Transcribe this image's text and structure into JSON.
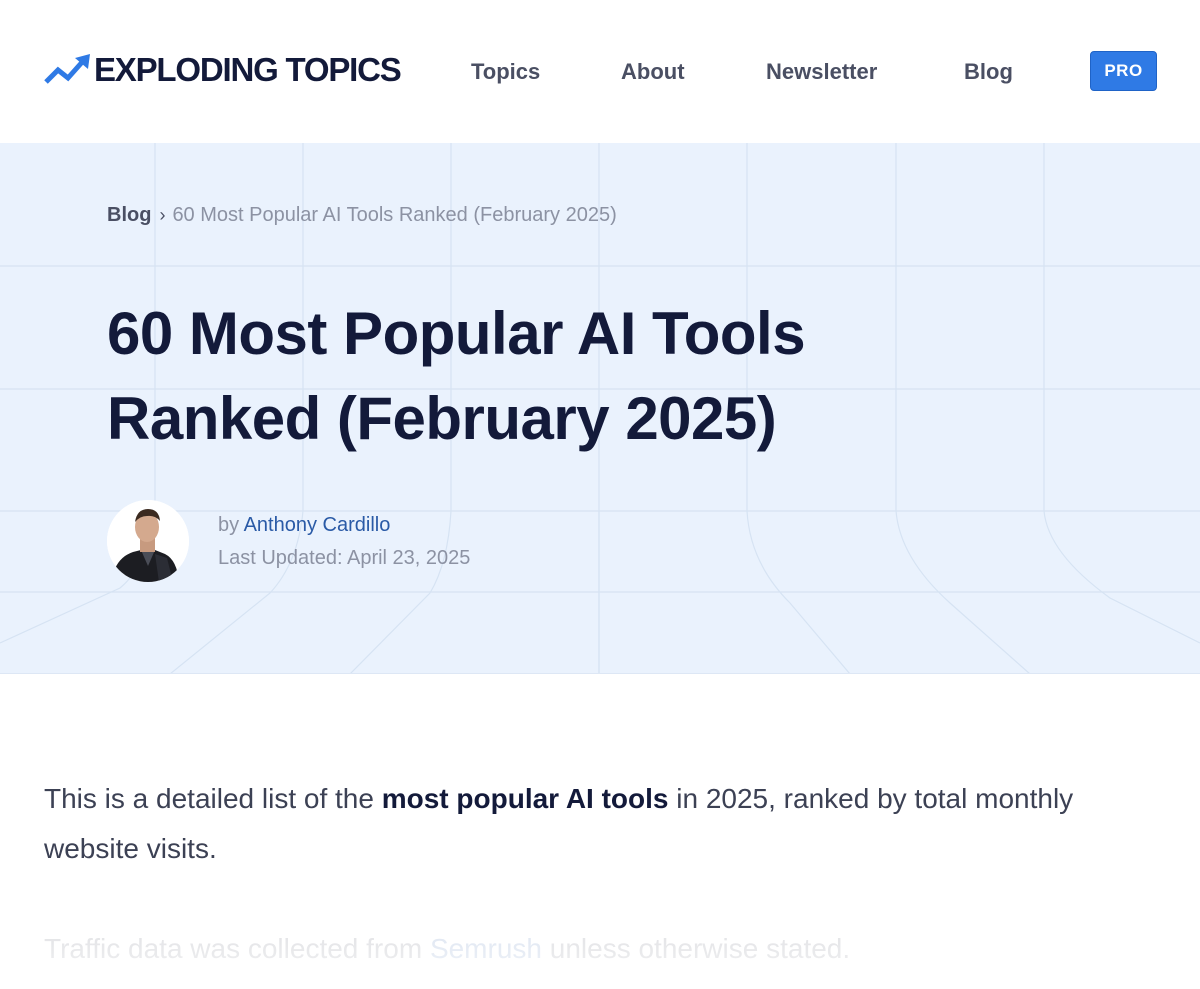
{
  "header": {
    "logo_text": "EXPLODING TOPICS",
    "logo_icon": "trend-arrow-icon",
    "nav": [
      {
        "label": "Topics"
      },
      {
        "label": "About"
      },
      {
        "label": "Newsletter"
      },
      {
        "label": "Blog"
      }
    ],
    "pro_label": "PRO"
  },
  "hero": {
    "breadcrumb": {
      "parent": "Blog",
      "separator": "›",
      "current": "60 Most Popular AI Tools Ranked (February 2025)"
    },
    "title": "60 Most Popular AI Tools Ranked (February 2025)",
    "author_prefix": "by",
    "author_name": "Anthony Cardillo",
    "updated": "Last Updated: April 23, 2025"
  },
  "body": {
    "intro_start": "This is a detailed list of the ",
    "intro_bold": "most popular AI tools",
    "intro_end": " in 2025, ranked by total monthly website visits.",
    "note_start": "Traffic data was collected from ",
    "note_link": "Semrush",
    "note_end": " unless otherwise stated."
  },
  "colors": {
    "brand_blue": "#2f7ae5",
    "heading_navy": "#131a3a",
    "hero_background": "#eaf2fd",
    "link_blue": "#2a5aa6"
  }
}
